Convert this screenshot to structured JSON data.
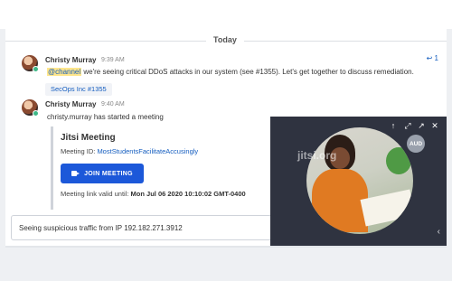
{
  "divider": {
    "label": "Today"
  },
  "messages": [
    {
      "author": "Christy Murray",
      "time": "9:39 AM",
      "mention": "@channel",
      "text": " we're seeing critical DDoS attacks in our system (see #1355). Let's get together to discuss remediation.",
      "reference": "SecOps Inc #1355",
      "reply_count": "1"
    },
    {
      "author": "Christy Murray",
      "time": "9:40 AM",
      "text": "christy.murray has started a meeting"
    }
  ],
  "meeting": {
    "title": "Jitsi Meeting",
    "id_label": "Meeting ID: ",
    "id_value": "MostStudentsFacilitateAccusingly",
    "join_label": "JOIN MEETING",
    "valid_label": "Meeting link valid until: ",
    "valid_value": "Mon Jul 06 2020 10:10:02 GMT-0400"
  },
  "compose": {
    "value": "Seeing suspicious traffic from IP 192.182.271.3912"
  },
  "video": {
    "watermark": "jitsi.org",
    "badge": "AUD"
  },
  "icons": {
    "reply": "reply-icon",
    "camera": "camera-icon",
    "arrow_up": "arrow-up-icon",
    "expand": "expand-icon",
    "popout": "popout-icon",
    "close": "close-icon",
    "chevron": "chevron-left-icon"
  },
  "colors": {
    "accent": "#1c58d9",
    "link": "#145dbf",
    "online": "#3db887",
    "mention_bg": "#ffe68c"
  }
}
